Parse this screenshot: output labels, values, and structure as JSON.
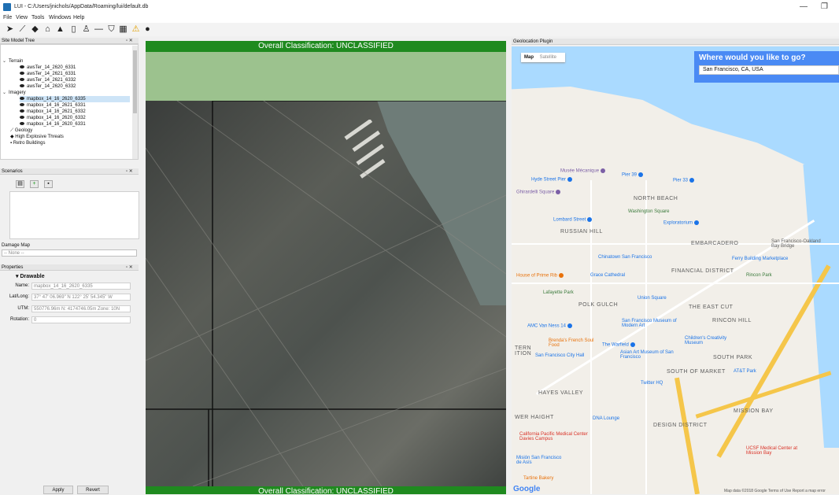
{
  "window": {
    "title": "LUI - C:/Users/jnichols/AppData/Roaming/lui/default.db",
    "minimize": "—",
    "restore": "❐"
  },
  "menu": [
    "File",
    "View",
    "Tools",
    "Windows",
    "Help"
  ],
  "toolbar_icons": [
    "pointer-icon",
    "measure-icon",
    "terrain-tool-icon",
    "building-icon",
    "tank-icon",
    "bridge-icon",
    "person-icon",
    "line-icon",
    "shield-icon",
    "grid-icon",
    "warning-icon",
    "bomb-icon"
  ],
  "site_model_tree": {
    "title": "Site Model Tree",
    "items": [
      {
        "label": "Terrain",
        "level": 0,
        "expanded": true
      },
      {
        "label": "awsTer_14_2620_6331",
        "level": 1
      },
      {
        "label": "awsTer_14_2621_6331",
        "level": 1
      },
      {
        "label": "awsTer_14_2621_6332",
        "level": 1
      },
      {
        "label": "awsTer_14_2620_6332",
        "level": 1
      },
      {
        "label": "Imagery",
        "level": 0,
        "expanded": true
      },
      {
        "label": "mapbox_14_16_2620_6335",
        "level": 1,
        "selected": true
      },
      {
        "label": "mapbox_14_16_2621_6331",
        "level": 1
      },
      {
        "label": "mapbox_14_16_2621_6332",
        "level": 1
      },
      {
        "label": "mapbox_14_16_2620_6332",
        "level": 1
      },
      {
        "label": "mapbox_14_16_2620_6331",
        "level": 1
      },
      {
        "label": "Geology",
        "level": 0
      },
      {
        "label": "High Explosive Threats",
        "level": 0
      },
      {
        "label": "Retro Buildings",
        "level": 0
      }
    ]
  },
  "scenarios": {
    "title": "Scenarios",
    "damage_map_label": "Damage Map",
    "damage_map_value": "-- None --"
  },
  "properties": {
    "title": "Properties",
    "section": "Drawable",
    "fields": [
      {
        "label": "Name:",
        "value": "mapbox_14_16_2620_6335"
      },
      {
        "label": "Lat/Long:",
        "value": "37° 47' 06.969\" N 122° 25' 54.345\" W"
      },
      {
        "label": "UTM:",
        "value": "550776.96m N: 4174746.05m Zone: 10N"
      },
      {
        "label": "Rotation:",
        "value": "0"
      }
    ],
    "apply": "Apply",
    "revert": "Revert"
  },
  "viewer": {
    "classification": "Overall Classification: UNCLASSIFIED"
  },
  "geolocation": {
    "title": "Geolocation Plugin",
    "map_tab": "Map",
    "satellite_tab": "Satellite",
    "search_title": "Where would you like to go?",
    "search_value": "San Francisco, CA, USA",
    "google": "Google",
    "footer": "Map data ©2018 Google   Terms of Use   Report a map error",
    "area_labels": [
      "NORTH BEACH",
      "RUSSIAN HILL",
      "EMBARCADERO",
      "FINANCIAL DISTRICT",
      "POLK GULCH",
      "THE EAST CUT",
      "RINCON HILL",
      "SOUTH PARK",
      "SOUTH OF MARKET",
      "HAYES VALLEY",
      "MISSION BAY",
      "DESIGN DISTRICT",
      "WER HAIGHT",
      "TERN ITION"
    ],
    "pois": [
      "Musée Mécanique",
      "Pier 39",
      "Pier 33",
      "Hyde Street Pier",
      "Ghirardelli Square",
      "Washington Square",
      "Lombard Street",
      "Exploratorium",
      "Chinatown San Francisco",
      "Ferry Building Marketplace",
      "House of Prime Rib",
      "Grace Cathedral",
      "Rincon Park",
      "Lafayette Park",
      "Union Square",
      "AMC Van Ness 14",
      "San Francisco Museum of Modern Art",
      "Brenda's French Soul Food",
      "The Warfield",
      "Children's Creativity Museum",
      "San Francisco City Hall",
      "Asian Art Museum of San Francisco",
      "AT&T Park",
      "Twitter HQ",
      "DNA Lounge",
      "California Pacific Medical Center Davies Campus",
      "Misión San Francisco de Asís",
      "UCSF Medical Center at Mission Bay",
      "Tartine Bakery",
      "San Francisco-Oakland Bay Bridge"
    ]
  }
}
